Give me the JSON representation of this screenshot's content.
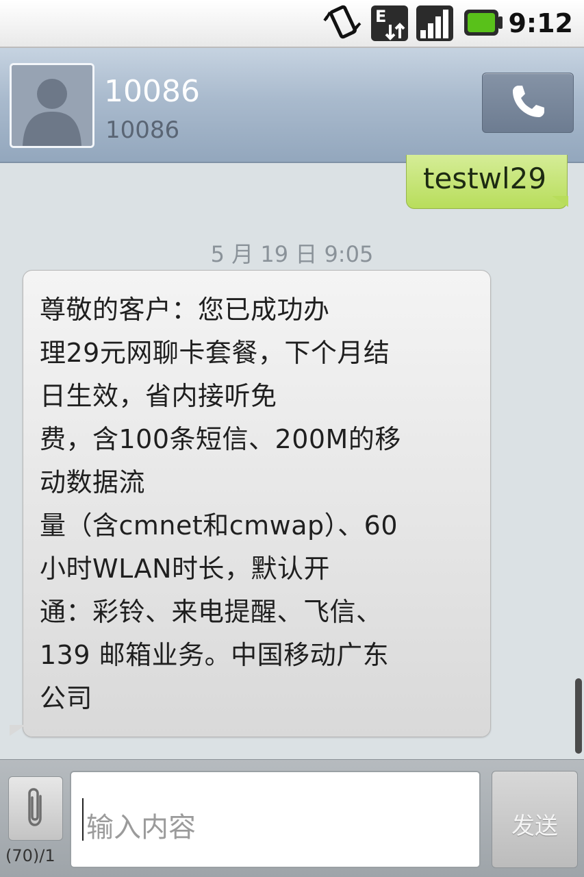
{
  "status_bar": {
    "time": "9:12",
    "icons": [
      "vibrate-icon",
      "data-e-icon",
      "signal-icon",
      "battery-icon"
    ]
  },
  "header": {
    "contact_name": "10086",
    "contact_number": "10086"
  },
  "conversation": {
    "sent_message": "testwl29",
    "timestamp": "5 月 19 日 9:05",
    "received_message": "尊敬的客户：您已成功办\n理29元网聊卡套餐，下个月结\n日生效，省内接听免\n费，含100条短信、200M的移\n动数据流\n量（含cmnet和cmwap）、60\n小时WLAN时长，默认开\n通：彩铃、来电提醒、飞信、\n139 邮箱业务。中国移动广东\n公司"
  },
  "compose": {
    "counter": "(70)/1",
    "placeholder": "输入内容",
    "send_label": "发送"
  },
  "colors": {
    "sent_bubble": "#b8dd5b",
    "header": "#a9bacd",
    "background": "#dbe1e4"
  }
}
